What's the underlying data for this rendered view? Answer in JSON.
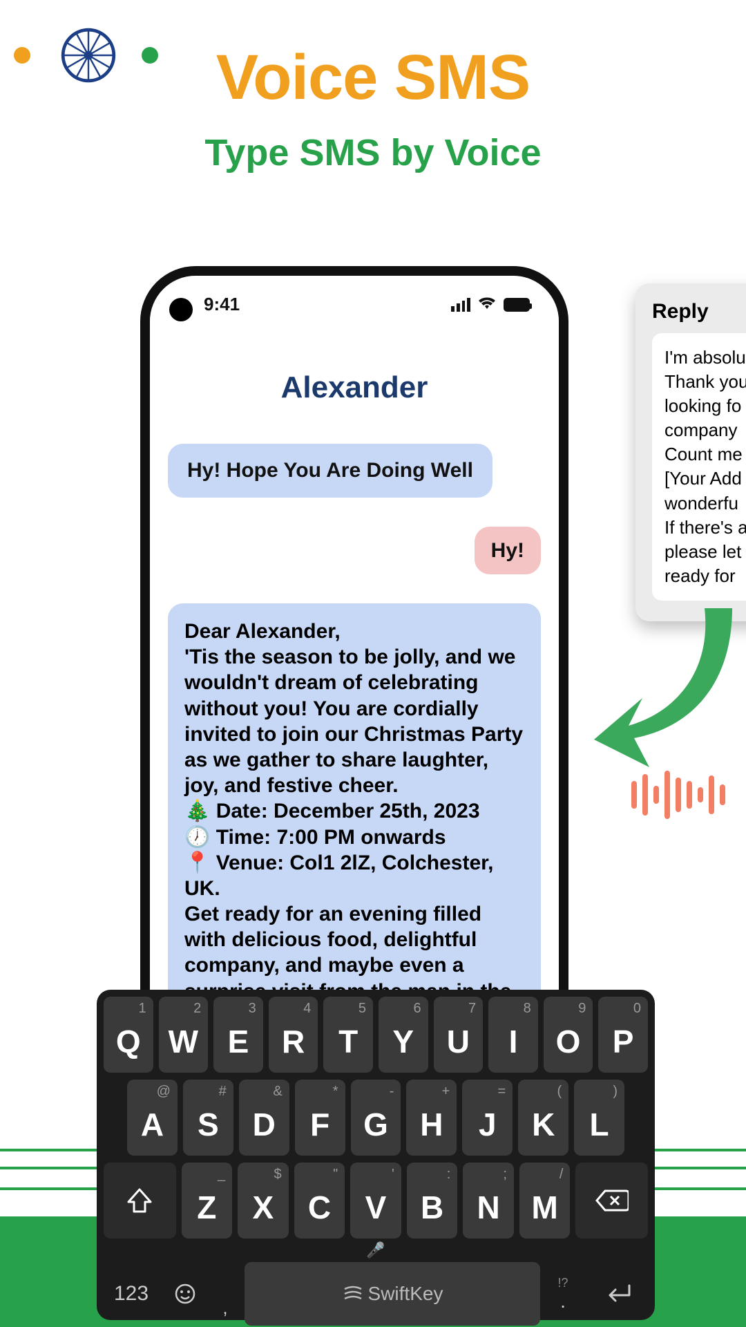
{
  "header": {
    "title": "Voice SMS",
    "subtitle": "Type SMS by Voice"
  },
  "phone": {
    "time": "9:41",
    "contact": "Alexander",
    "msg_in_1": "Hy! Hope You Are Doing Well",
    "msg_out_1": "Hy!",
    "msg_in_2": "Dear Alexander,\n'Tis the season to be jolly, and we wouldn't dream of celebrating without you! You are cordially invited to join our Christmas Party as we gather to share laughter, joy, and festive cheer.\n🎄 Date: December 25th, 2023\n🕖 Time: 7:00 PM onwards\n📍 Venue: Col1 2lZ, Colchester, UK.\nGet ready for an evening filled with delicious food, delightful company, and maybe even a surprise visit from the man in the red suit! We've lined up some festive activities and games to ensure"
  },
  "reply": {
    "title": "Reply",
    "body": "I'm absolutely ... Thank you ... looking forward ... company ... Count me ... [Your Address] wonderful ... If there's anything please let ... ready for"
  },
  "keyboard": {
    "row1": [
      {
        "sup": "1",
        "main": "Q"
      },
      {
        "sup": "2",
        "main": "W"
      },
      {
        "sup": "3",
        "main": "E"
      },
      {
        "sup": "4",
        "main": "R"
      },
      {
        "sup": "5",
        "main": "T"
      },
      {
        "sup": "6",
        "main": "Y"
      },
      {
        "sup": "7",
        "main": "U"
      },
      {
        "sup": "8",
        "main": "I"
      },
      {
        "sup": "9",
        "main": "O"
      },
      {
        "sup": "0",
        "main": "P"
      }
    ],
    "row2": [
      {
        "sup": "@",
        "main": "A"
      },
      {
        "sup": "#",
        "main": "S"
      },
      {
        "sup": "&",
        "main": "D"
      },
      {
        "sup": "*",
        "main": "F"
      },
      {
        "sup": "-",
        "main": "G"
      },
      {
        "sup": "+",
        "main": "H"
      },
      {
        "sup": "=",
        "main": "J"
      },
      {
        "sup": "(",
        "main": "K"
      },
      {
        "sup": ")",
        "main": "L"
      }
    ],
    "row3": [
      {
        "sup": "_",
        "main": "Z"
      },
      {
        "sup": "$",
        "main": "X"
      },
      {
        "sup": "\"",
        "main": "C"
      },
      {
        "sup": "'",
        "main": "V"
      },
      {
        "sup": ":",
        "main": "B"
      },
      {
        "sup": ";",
        "main": "N"
      },
      {
        "sup": "/",
        "main": "M"
      }
    ],
    "numeric_label": "123",
    "brand": "SwiftKey",
    "punct": "!?"
  }
}
